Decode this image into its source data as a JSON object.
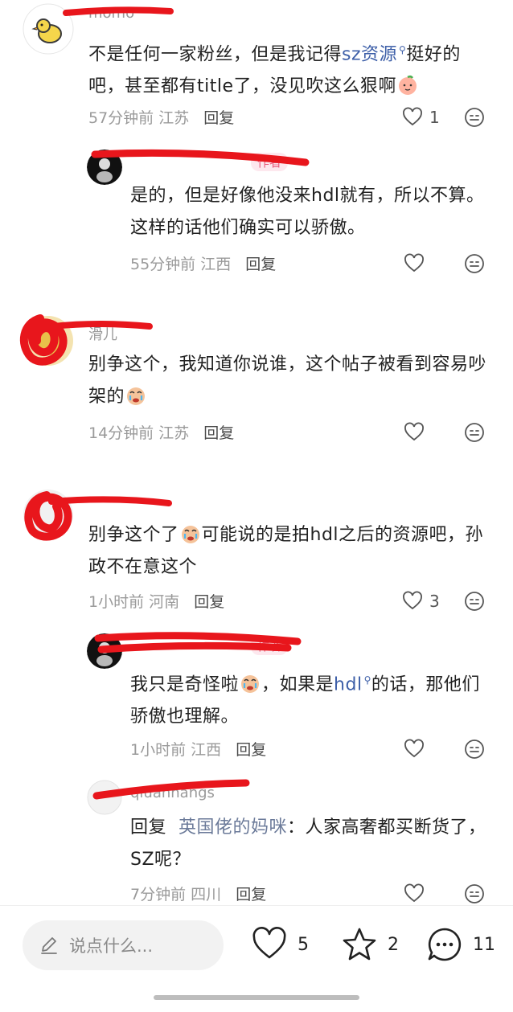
{
  "comments": [
    {
      "username": "momo",
      "text_a": "不是任何一家粉丝，但是我记得",
      "link": "sz资源",
      "text_b": "挺好的吧，甚至都有title了，没见吹这么狠啊",
      "emoji": "peach-emoji",
      "time": "57分钟前",
      "location": "江苏",
      "reply_label": "回复",
      "likes": "1",
      "replies": [
        {
          "username": "",
          "author_tag": "作者",
          "text": "是的，但是好像他没来hdl就有，所以不算。这样的话他们确实可以骄傲。",
          "time": "55分钟前",
          "location": "江西",
          "reply_label": "回复",
          "likes": ""
        }
      ]
    },
    {
      "username": "滑儿",
      "text": "别争这个，我知道你说谁，这个帖子被看到容易吵架的",
      "emoji": "crying-emoji",
      "time": "14分钟前",
      "location": "江苏",
      "reply_label": "回复",
      "likes": ""
    },
    {
      "username": "",
      "text_a": "别争这个了",
      "emoji": "crying-emoji",
      "text_b": "可能说的是拍hdl之后的资源吧，孙政不在意这个",
      "time": "1小时前",
      "location": "河南",
      "reply_label": "回复",
      "likes": "3",
      "replies": [
        {
          "username": "",
          "author_tag": "作者",
          "text_a": "我只是奇怪啦",
          "emoji": "crying-emoji",
          "text_b": "，如果是",
          "link": "hdl",
          "text_c": "的话，那他们骄傲也理解。",
          "time": "1小时前",
          "location": "江西",
          "reply_label": "回复",
          "likes": ""
        },
        {
          "username": "qiuanhangs",
          "reply_prefix": "回复",
          "mention": "英国佬的妈咪",
          "text": "：人家高奢都买断货了，SZ呢？",
          "time": "7分钟前",
          "location": "四川",
          "reply_label": "回复",
          "likes": ""
        }
      ]
    }
  ],
  "bottom_bar": {
    "input_placeholder": "说点什么...",
    "likes": "5",
    "favorites": "2",
    "comments": "11"
  },
  "colors": {
    "link": "#3d5fa8",
    "redaction": "#e8161c",
    "meta_gray": "#9a9a9a"
  }
}
